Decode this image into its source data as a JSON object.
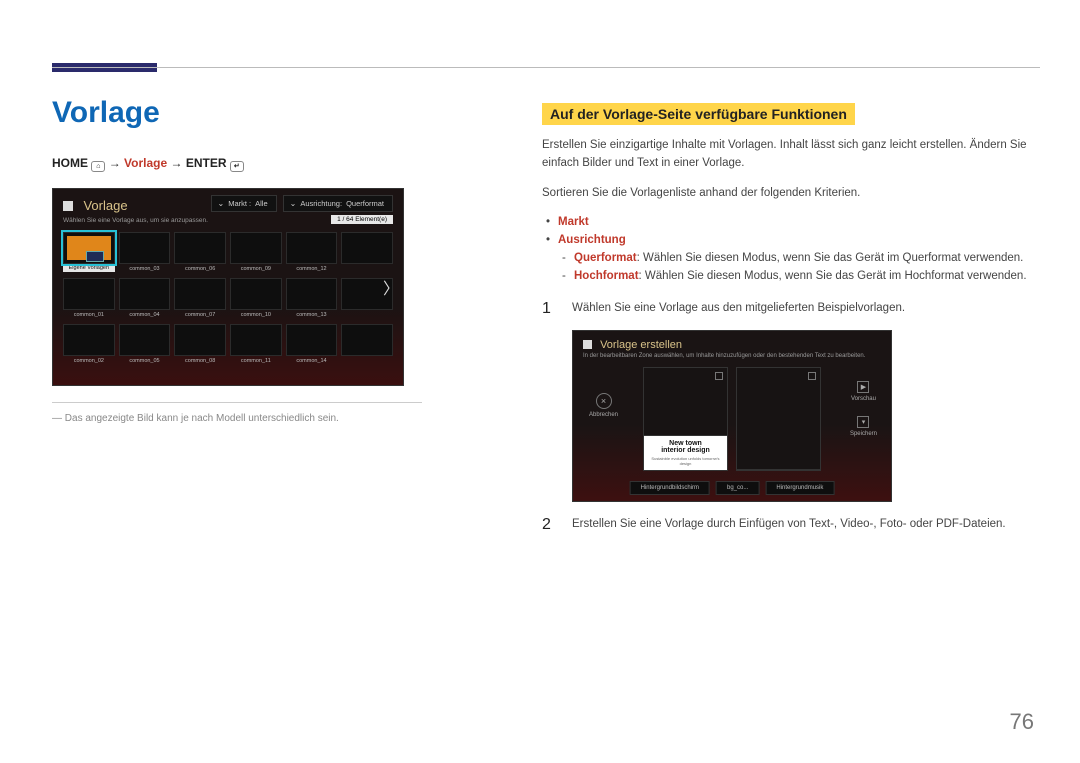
{
  "page_number": "76",
  "left": {
    "title": "Vorlage",
    "breadcrumb": {
      "home": "HOME",
      "arrow": "→",
      "mid": "Vorlage",
      "enter": "ENTER"
    },
    "footnote": "Das angezeigte Bild kann je nach Modell unterschiedlich sein."
  },
  "shot1": {
    "title": "Vorlage",
    "subtitle": "Wählen Sie eine Vorlage aus, um sie anzupassen.",
    "tab_market_label": "Markt :",
    "tab_market_value": "Alle",
    "tab_orient_label": "Ausrichtung:",
    "tab_orient_value": "Querformat",
    "counter": "1 / 64 Element(e)",
    "first_cell_label": "Eigene Vorlagen",
    "labels_r1": [
      "common_03",
      "common_06",
      "common_09",
      "common_12",
      ""
    ],
    "labels_r2": [
      "common_01",
      "common_04",
      "common_07",
      "common_10",
      "common_13",
      ""
    ],
    "labels_r3": [
      "common_02",
      "common_05",
      "common_08",
      "common_11",
      "common_14",
      ""
    ]
  },
  "right": {
    "section_title": "Auf der Vorlage-Seite verfügbare Funktionen",
    "intro1": "Erstellen Sie einzigartige Inhalte mit Vorlagen. Inhalt lässt sich ganz leicht erstellen. Ändern Sie einfach Bilder und Text in einer Vorlage.",
    "intro2": "Sortieren Sie die Vorlagenliste anhand der folgenden Kriterien.",
    "bullets": {
      "markt": "Markt",
      "ausrichtung": "Ausrichtung",
      "quer_key": "Querformat",
      "quer_txt": ": Wählen Sie diesen Modus, wenn Sie das Gerät im Querformat verwenden.",
      "hoch_key": "Hochformat",
      "hoch_txt": ": Wählen Sie diesen Modus, wenn Sie das Gerät im Hochformat verwenden."
    },
    "step1_n": "1",
    "step1_txt": "Wählen Sie eine Vorlage aus den mitgelieferten Beispielvorlagen.",
    "step2_n": "2",
    "step2_txt": "Erstellen Sie eine Vorlage durch Einfügen von Text-, Video-, Foto- oder PDF-Dateien."
  },
  "shot2": {
    "title": "Vorlage erstellen",
    "subtitle": "In der bearbeitbaren Zone auswählen, um Inhalte hinzuzufügen oder den bestehenden Text zu bearbeiten.",
    "cancel": "Abbrechen",
    "preview": "Vorschau",
    "save": "Speichern",
    "card_t1": "New town",
    "card_t2": "interior design",
    "card_t3": "Sustainble evolution unfolds tomorrw's design",
    "btm1": "Hintergrundbildschirm",
    "btm2": "bg_co...",
    "btm3": "Hintergrundmusik"
  }
}
